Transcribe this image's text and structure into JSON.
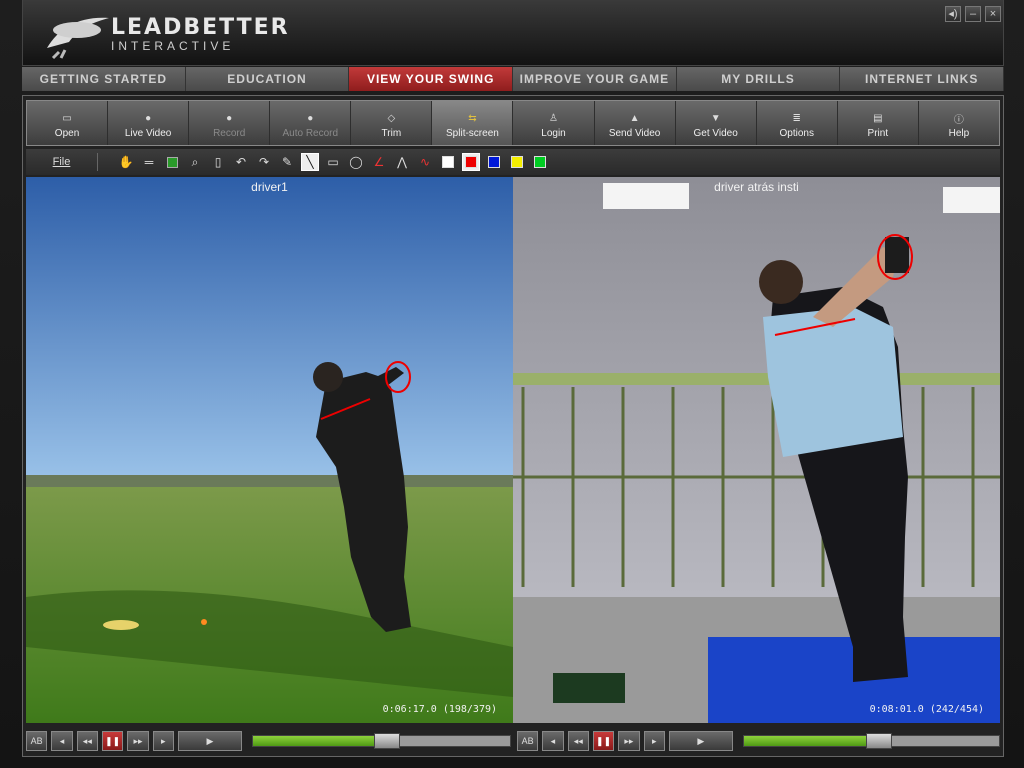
{
  "app": {
    "logo_title": "LEADBETTER",
    "logo_subtitle": "INTERACTIVE",
    "window_buttons": [
      "sound-icon",
      "minimize-icon",
      "close-icon"
    ]
  },
  "nav": {
    "tabs": [
      {
        "label": "GETTING STARTED",
        "active": false
      },
      {
        "label": "EDUCATION",
        "active": false
      },
      {
        "label": "VIEW YOUR SWING",
        "active": true
      },
      {
        "label": "IMPROVE YOUR GAME",
        "active": false
      },
      {
        "label": "MY DRILLS",
        "active": false
      },
      {
        "label": "INTERNET LINKS",
        "active": false
      }
    ]
  },
  "toolbar": {
    "buttons": [
      {
        "label": "Open",
        "icon": "folder-icon",
        "enabled": true
      },
      {
        "label": "Live Video",
        "icon": "camera-icon",
        "enabled": true
      },
      {
        "label": "Record",
        "icon": "record-icon",
        "enabled": false
      },
      {
        "label": "Auto Record",
        "icon": "record-icon",
        "enabled": false
      },
      {
        "label": "Trim",
        "icon": "trim-icon",
        "enabled": true
      },
      {
        "label": "Split-screen",
        "icon": "split-icon",
        "enabled": true,
        "active": true
      },
      {
        "label": "Login",
        "icon": "user-icon",
        "enabled": true
      },
      {
        "label": "Send Video",
        "icon": "upload-icon",
        "enabled": true
      },
      {
        "label": "Get Video",
        "icon": "download-icon",
        "enabled": true
      },
      {
        "label": "Options",
        "icon": "options-icon",
        "enabled": true
      },
      {
        "label": "Print",
        "icon": "printer-icon",
        "enabled": true
      },
      {
        "label": "Help",
        "icon": "info-icon",
        "enabled": true
      }
    ]
  },
  "drawbar": {
    "file_label": "File",
    "tools": [
      "hand-icon",
      "equals-icon",
      "green-square-icon",
      "zoom-icon",
      "eraser-icon",
      "undo-icon",
      "redo-icon",
      "pencil-icon",
      "line-icon",
      "rectangle-icon",
      "circle-icon",
      "angle-icon",
      "compass-icon",
      "curve-icon"
    ],
    "selected_tool": "line-icon",
    "colors": [
      "#ffffff",
      "#ee0000",
      "#0018d8",
      "#f4ee00",
      "#00cc22"
    ],
    "selected_color": "#ee0000"
  },
  "videos": {
    "left": {
      "title": "driver1",
      "timecode": "0:06:17.0 (198/379)",
      "progress": 0.52
    },
    "right": {
      "title": "driver atrás insti",
      "timecode": "0:08:01.0 (242/454)",
      "progress": 0.53
    }
  },
  "controls": {
    "buttons": [
      "ab-loop-icon",
      "step-back-icon",
      "slow-back-icon",
      "pause-icon",
      "slow-forward-icon",
      "step-forward-icon",
      "play-icon"
    ],
    "ab_label": "AB"
  }
}
